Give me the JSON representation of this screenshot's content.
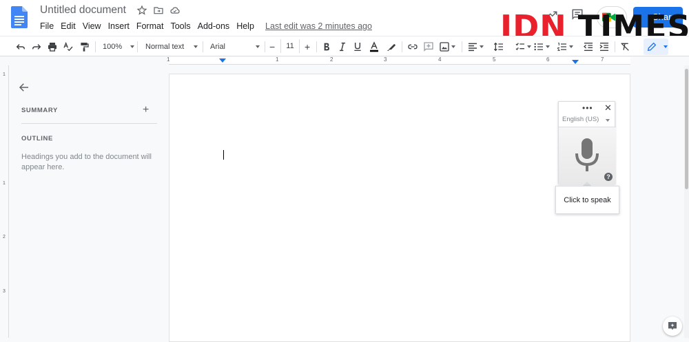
{
  "app": {
    "title": "Untitled document",
    "last_edit": "Last edit was 2 minutes ago",
    "share_label": "Share"
  },
  "menu": [
    "File",
    "Edit",
    "View",
    "Insert",
    "Format",
    "Tools",
    "Add-ons",
    "Help"
  ],
  "toolbar": {
    "zoom": "100%",
    "style": "Normal text",
    "font": "Arial",
    "font_size": "11",
    "minus": "−",
    "plus": "+"
  },
  "ruler": {
    "numbers": [
      "1",
      "1",
      "2",
      "3",
      "4",
      "5",
      "6",
      "7"
    ],
    "vertical_numbers": [
      "1",
      "1",
      "2",
      "3"
    ]
  },
  "outline_panel": {
    "summary_label": "SUMMARY",
    "outline_label": "OUTLINE",
    "hint": "Headings you add to the document will appear here."
  },
  "voice_typing": {
    "language": "English (US)",
    "tooltip": "Click to speak",
    "help": "?"
  },
  "watermark": {
    "brand_red": "IDN",
    "brand_black": "TIMES"
  },
  "colors": {
    "accent": "#1a73e8",
    "doc_blue": "#4285f4",
    "watermark_red": "#e8212c"
  }
}
